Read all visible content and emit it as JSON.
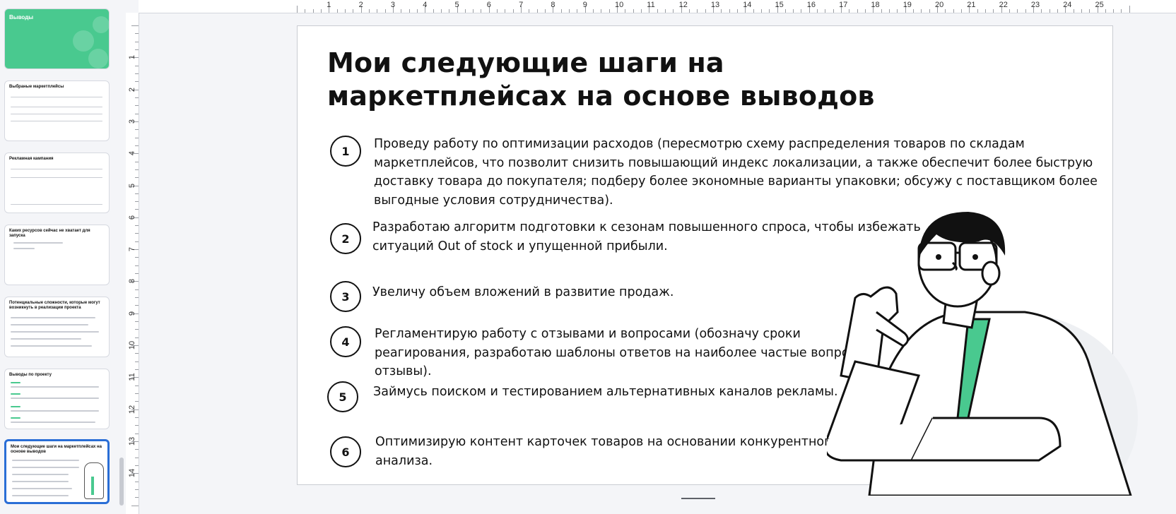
{
  "sidebar": {
    "slides": [
      {
        "title": "Выводы"
      },
      {
        "title": "Выбраные маркетплейсы"
      },
      {
        "title": "Рекламная кампания"
      },
      {
        "title": "Каких ресурсов сейчас не хватает для запуска"
      },
      {
        "title": "Потенциальные сложности, которые могут возникнуть в реализации проекта"
      },
      {
        "title": "Выводы по проекту"
      },
      {
        "title": "Мои следующие шаги на маркетплейсах на основе выводов"
      }
    ]
  },
  "ruler": {
    "top_labels": [
      "1",
      "2",
      "3",
      "4",
      "5",
      "6",
      "7",
      "8",
      "9",
      "10",
      "11",
      "12",
      "13",
      "14",
      "15",
      "16",
      "17",
      "18",
      "19",
      "20",
      "21",
      "22",
      "23",
      "24",
      "25"
    ],
    "left_labels": [
      "1",
      "2",
      "3",
      "4",
      "5",
      "6",
      "7",
      "8",
      "9",
      "10",
      "11",
      "12",
      "13",
      "14"
    ]
  },
  "slide": {
    "title": "Мои следующие шаги на маркетплейсах на основе выводов",
    "steps": [
      {
        "number": "1",
        "lines": [
          "Проведу работу по оптимизации расходов (пересмотрю схему распределения товаров по складам",
          "маркетплейсов, что позволит снизить повышающий индекс локализации, а также обеспечит более быструю",
          "доставку товара до покупателя; подберу более экономные варианты упаковки; обсужу с поставщиком более",
          "выгодные условия сотрудничества)."
        ]
      },
      {
        "number": "2",
        "lines": [
          "Разработаю алгоритм подготовки к сезонам повышенного спроса, чтобы избежать",
          "ситуаций Out of stock и упущенной прибыли."
        ]
      },
      {
        "number": "3",
        "lines": [
          "Увеличу объем вложений в развитие продаж."
        ]
      },
      {
        "number": "4",
        "lines": [
          "Регламентирую работу с отзывами и вопросами (обозначу сроки",
          "реагирования, разработаю шаблоны ответов на наиболее частые вопросы и",
          "отзывы)."
        ]
      },
      {
        "number": "5",
        "lines": [
          "Займусь поиском и тестированием альтернативных каналов рекламы."
        ]
      },
      {
        "number": "6",
        "lines": [
          "Оптимизирую контент карточек товаров на основании конкурентного",
          "анализа."
        ]
      }
    ]
  },
  "colors": {
    "accent_green": "#49c98f",
    "selection_blue": "#2a6ed6"
  }
}
